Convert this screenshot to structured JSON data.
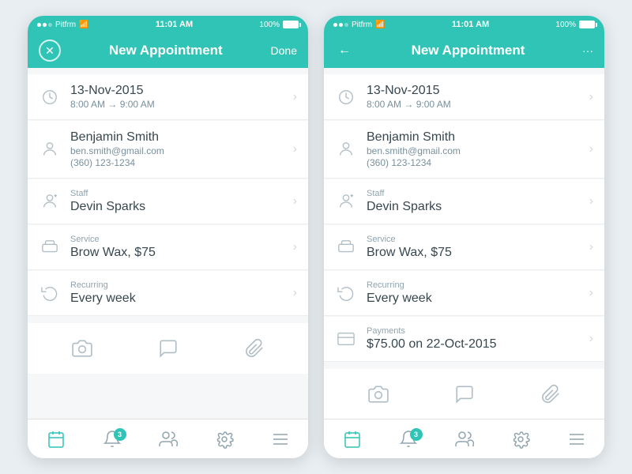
{
  "phone1": {
    "statusBar": {
      "carrier": "Pitfrm",
      "time": "11:01 AM",
      "battery": "100%"
    },
    "navBar": {
      "title": "New Appointment",
      "leftBtn": "✕",
      "rightBtn": "Done"
    },
    "items": [
      {
        "id": "datetime",
        "icon": "clock",
        "line1": "13-Nov-2015",
        "line2": "8:00 AM  →  9:00 AM"
      },
      {
        "id": "client",
        "icon": "person",
        "line1": "Benjamin Smith",
        "line2": "ben.smith@gmail.com",
        "line3": "(360) 123-1234"
      },
      {
        "id": "staff",
        "icon": "staff",
        "label": "Staff",
        "line1": "Devin Sparks"
      },
      {
        "id": "service",
        "icon": "service",
        "label": "Service",
        "line1": "Brow Wax, $75"
      },
      {
        "id": "recurring",
        "icon": "recurring",
        "label": "Recurring",
        "line1": "Every week"
      }
    ],
    "actions": [
      "camera",
      "message",
      "attachment"
    ],
    "tabs": [
      {
        "id": "calendar",
        "active": true,
        "badge": null
      },
      {
        "id": "bell",
        "active": false,
        "badge": "3"
      },
      {
        "id": "people",
        "active": false,
        "badge": null
      },
      {
        "id": "gear",
        "active": false,
        "badge": null
      },
      {
        "id": "menu",
        "active": false,
        "badge": null
      }
    ]
  },
  "phone2": {
    "statusBar": {
      "carrier": "Pitfrm",
      "time": "11:01 AM",
      "battery": "100%"
    },
    "navBar": {
      "title": "New Appointment",
      "leftBtn": "←",
      "rightBtn": "···"
    },
    "items": [
      {
        "id": "datetime",
        "icon": "clock",
        "line1": "13-Nov-2015",
        "line2": "8:00 AM  →  9:00 AM"
      },
      {
        "id": "client",
        "icon": "person",
        "line1": "Benjamin Smith",
        "line2": "ben.smith@gmail.com",
        "line3": "(360) 123-1234"
      },
      {
        "id": "staff",
        "icon": "staff",
        "label": "Staff",
        "line1": "Devin Sparks"
      },
      {
        "id": "service",
        "icon": "service",
        "label": "Service",
        "line1": "Brow Wax, $75"
      },
      {
        "id": "recurring",
        "icon": "recurring",
        "label": "Recurring",
        "line1": "Every week"
      },
      {
        "id": "payments",
        "icon": "payment",
        "label": "Payments",
        "line1": "$75.00 on 22-Oct-2015"
      }
    ],
    "actions": [
      "camera",
      "message",
      "attachment"
    ],
    "tabs": [
      {
        "id": "calendar",
        "active": true,
        "badge": null
      },
      {
        "id": "bell",
        "active": false,
        "badge": "3"
      },
      {
        "id": "people",
        "active": false,
        "badge": null
      },
      {
        "id": "gear",
        "active": false,
        "badge": null
      },
      {
        "id": "menu",
        "active": false,
        "badge": null
      }
    ]
  }
}
